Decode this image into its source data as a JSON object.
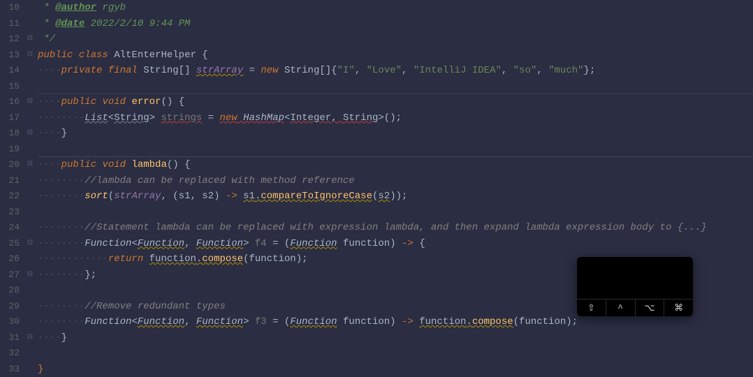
{
  "gutter": {
    "start": 10,
    "end": 33
  },
  "fold_markers": {
    "12": "⊟",
    "13": "⊟",
    "14": "",
    "16": "⊟",
    "18": "⊟",
    "20": "⊟",
    "25": "⊟",
    "27": "⊟",
    "31": "⊟"
  },
  "lines": {
    "10": {
      "doc_prefix": " * ",
      "tag": "@author",
      "tag_val": " rgyb"
    },
    "11": {
      "doc_prefix": " * ",
      "tag": "@date",
      "tag_val": " 2022/2/10 9:44 PM"
    },
    "12": {
      "doc_end": " */"
    },
    "13": {
      "kw1": "public",
      "kw2": "class",
      "classname": "AltEnterHelper",
      "brace": "{"
    },
    "14": {
      "kw1": "private",
      "kw2": "final",
      "type": "String",
      "arr": "[]",
      "field": "strArray",
      "eq": " = ",
      "kw3": "new",
      "type2": "String",
      "arr2": "[]{",
      "s1": "\"I\"",
      "s2": "\"Love\"",
      "s3": "\"IntelliJ IDEA\"",
      "s4": "\"so\"",
      "s5": "\"much\"",
      "close": "};"
    },
    "16": {
      "kw1": "public",
      "kw2": "void",
      "method": "error",
      "parens": "()",
      "brace": " {"
    },
    "17": {
      "type1": "List",
      "g1": "<",
      "type2": "String",
      "g2": "> ",
      "var": "strings",
      "eq": " = ",
      "kw": "new",
      "sp": " ",
      "type3": "HashMap",
      "g3": "<",
      "type4": "Integer",
      "comma": ", ",
      "type5": "String",
      "g4": ">",
      "end": "();"
    },
    "18": {
      "brace": "}"
    },
    "20": {
      "kw1": "public",
      "kw2": "void",
      "method": "lambda",
      "parens": "()",
      "brace": " {"
    },
    "21": {
      "cmt": "//lambda can be replaced with method reference"
    },
    "22": {
      "call": "sort",
      "open": "(",
      "arg1": "strArray",
      "c1": ", (",
      "p1": "s1",
      "pc": ", ",
      "p2": "s2",
      "close1": ") ",
      "arrow": "-> ",
      "obj": "s1",
      "dot": ".",
      "meth": "compareToIgnoreCase",
      "open2": "(",
      "p3": "s2",
      "close2": "));"
    },
    "24": {
      "cmt": "//Statement lambda can be replaced with expression lambda, and then expand lambda expression body to {...}"
    },
    "25": {
      "type1": "Function",
      "g1": "<",
      "type2": "Function",
      "c1": ", ",
      "type3": "Function",
      "g2": "> ",
      "var": "f4",
      "eq": " = (",
      "ptype": "Function",
      "sp": " ",
      "param": "function",
      "close": ") ",
      "arrow": "-> ",
      "brace": "{"
    },
    "26": {
      "kw": "return",
      "sp": " ",
      "obj": "function",
      "dot": ".",
      "meth": "compose",
      "open": "(",
      "arg": "function",
      "close": ");"
    },
    "27": {
      "brace": "};"
    },
    "29": {
      "cmt": "//Remove redundant types"
    },
    "30": {
      "type1": "Function",
      "g1": "<",
      "type2": "Function",
      "c1": ", ",
      "type3": "Function",
      "g2": "> ",
      "var": "f3",
      "eq": " = (",
      "ptype": "Function",
      "sp": " ",
      "param": "function",
      "close": ") ",
      "arrow": "-> ",
      "obj": "function",
      "dot": ".",
      "meth": "compose",
      "open": "(",
      "arg": "function",
      "close2": ");"
    },
    "31": {
      "brace": "}"
    },
    "33": {
      "brace": "}"
    }
  },
  "overlay": {
    "keys": [
      "⇧",
      "^",
      "⌥",
      "⌘"
    ]
  }
}
